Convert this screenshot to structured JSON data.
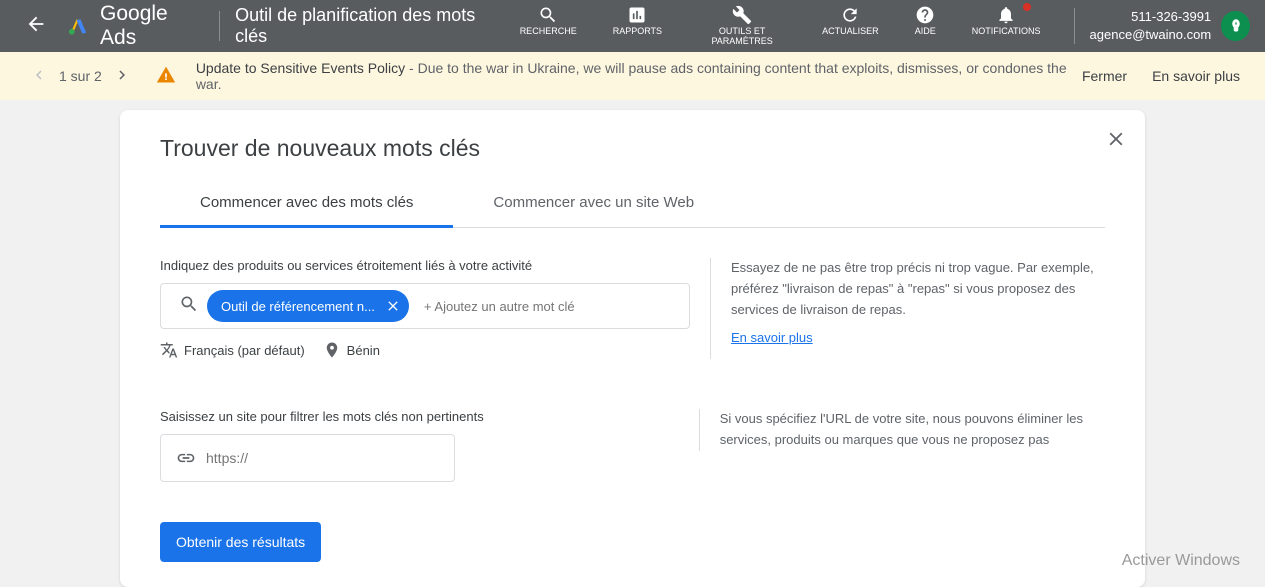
{
  "header": {
    "brand": "Google Ads",
    "pageTitle": "Outil de planification des mots clés",
    "nav": {
      "search": "RECHERCHE",
      "reports": "RAPPORTS",
      "tools": "OUTILS ET PARAMÈTRES",
      "refresh": "ACTUALISER",
      "help": "AIDE",
      "notifications": "NOTIFICATIONS"
    },
    "account": {
      "phone": "511-326-3991",
      "email": "agence@twaino.com"
    }
  },
  "notifBar": {
    "pager": "1 sur 2",
    "title": "Update to Sensitive Events Policy",
    "body": " - Due to the war in Ukraine, we will pause ads containing content that exploits, dismisses, or condones the war.",
    "close": "Fermer",
    "more": "En savoir plus"
  },
  "card": {
    "title": "Trouver de nouveaux mots clés",
    "tabs": {
      "keywords": "Commencer avec des mots clés",
      "website": "Commencer avec un site Web"
    },
    "field1Label": "Indiquez des produits ou services étroitement liés à votre activité",
    "chip": "Outil de référencement n...",
    "addKw": "+ Ajoutez un autre mot clé",
    "language": "Français (par défaut)",
    "location": "Bénin",
    "help1": "Essayez de ne pas être trop précis ni trop vague. Par exemple, préférez \"livraison de repas\" à \"repas\" si vous proposez des services de livraison de repas.",
    "helpLink": "En savoir plus",
    "field2Label": "Saisissez un site pour filtrer les mots clés non pertinents",
    "urlPlaceholder": "https://",
    "help2": "Si vous spécifiez l'URL de votre site, nous pouvons éliminer les services, produits ou marques que vous ne proposez pas",
    "submit": "Obtenir des résultats"
  },
  "overlay": "Activer Windows"
}
